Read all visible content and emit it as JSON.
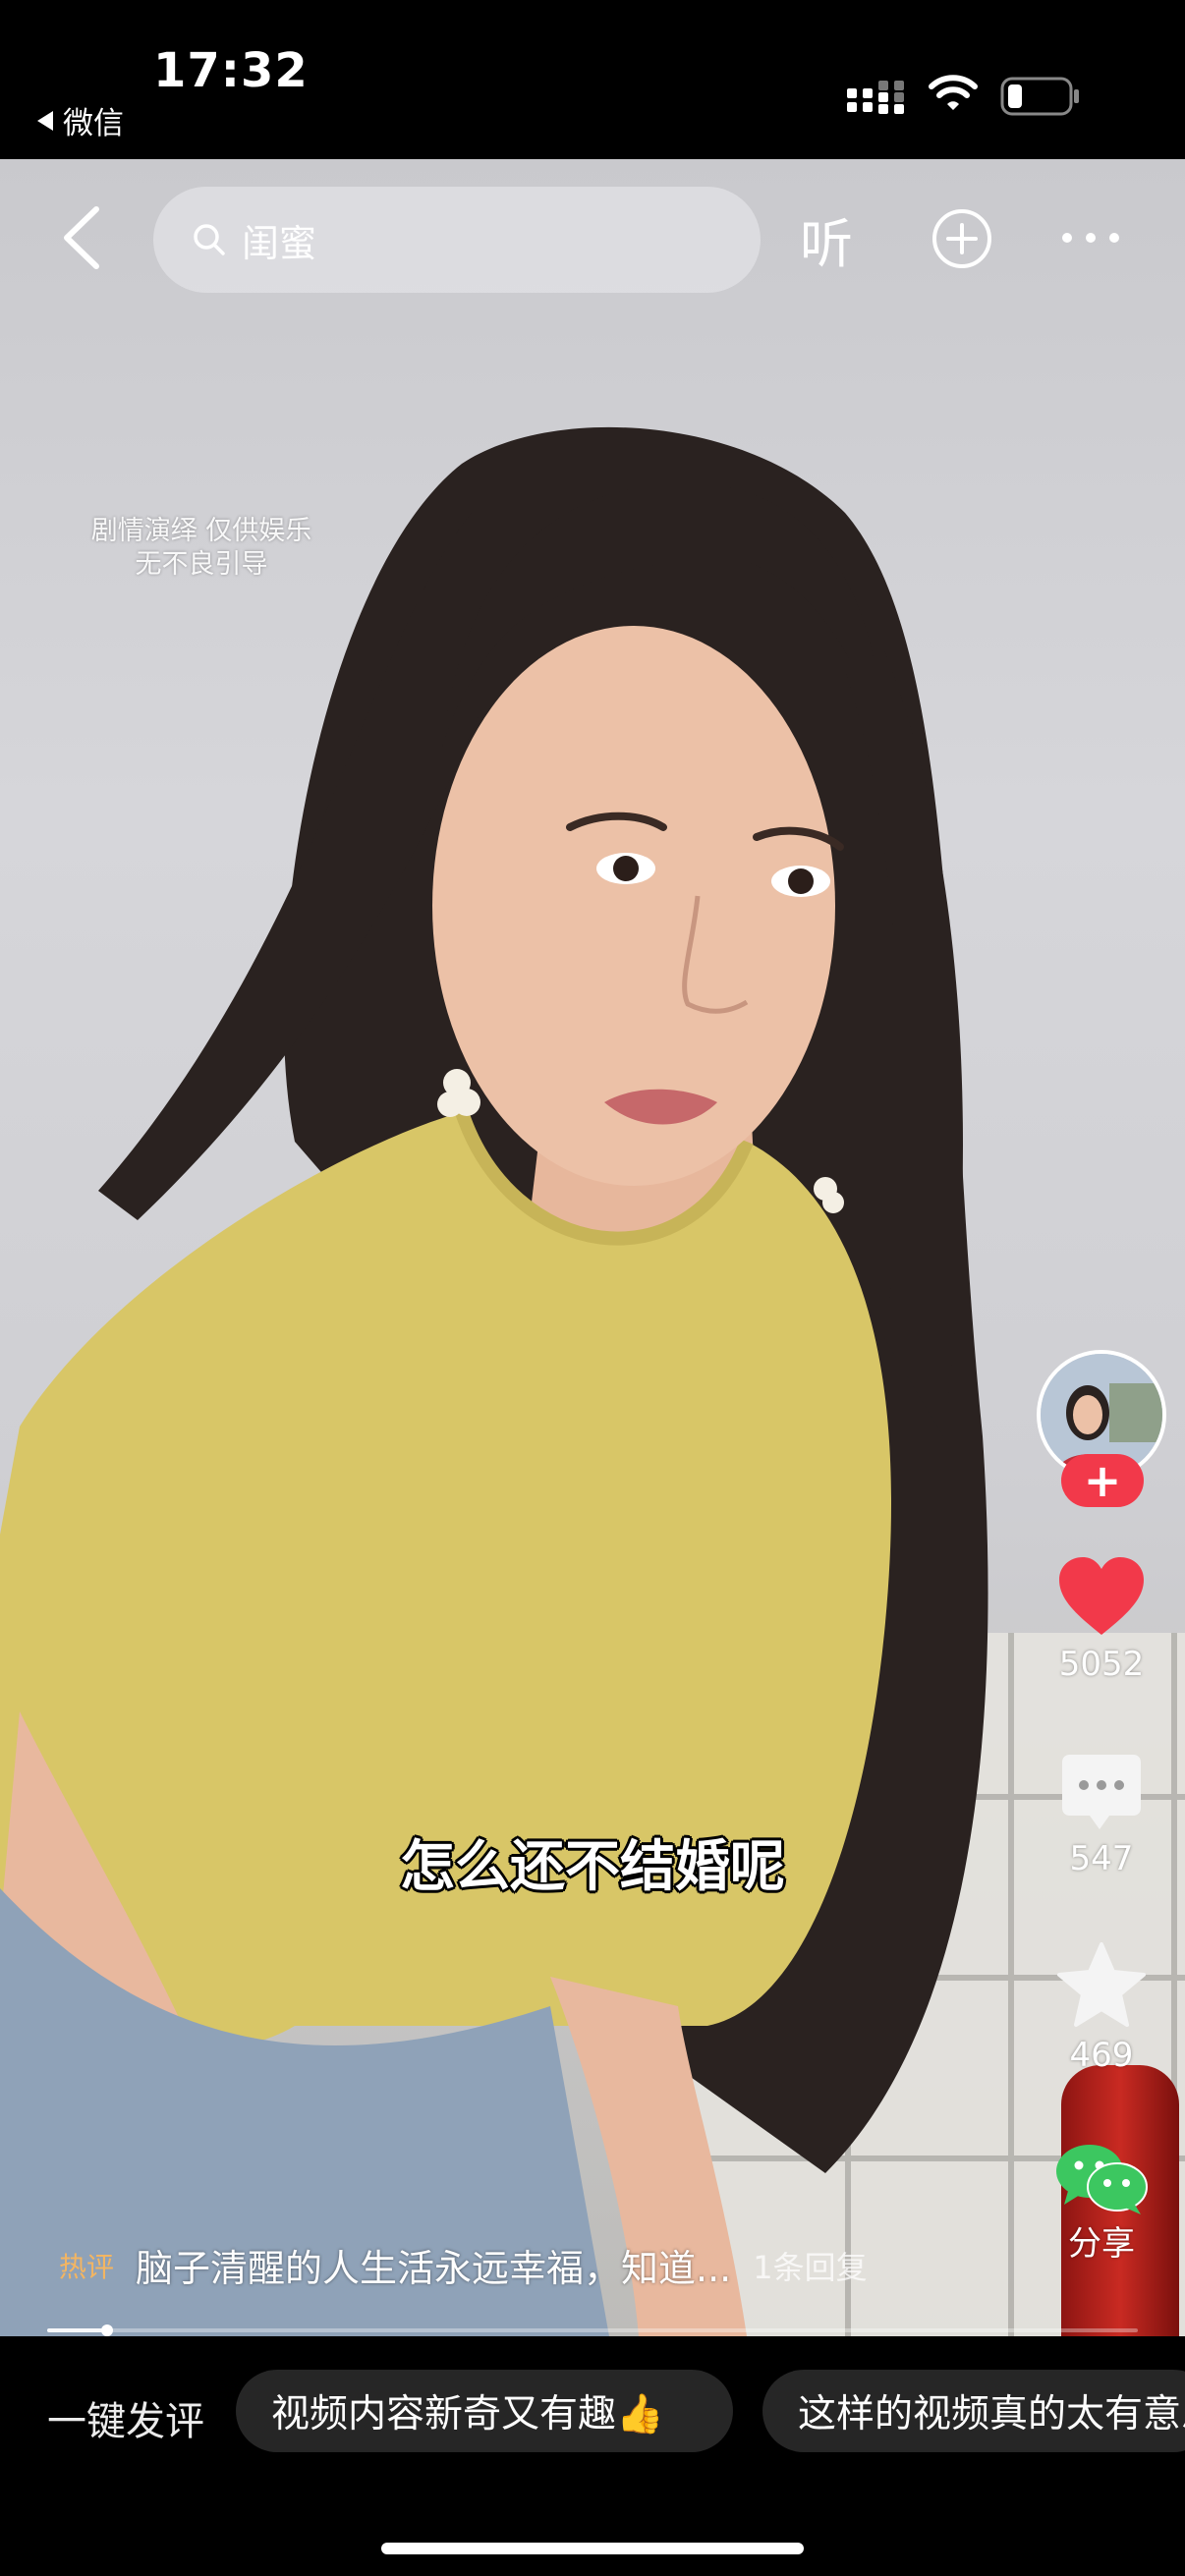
{
  "status_bar": {
    "time": "17:32",
    "back_app": "微信",
    "icons": [
      "cellular-signal-icon",
      "wifi-icon",
      "battery-icon"
    ]
  },
  "top_nav": {
    "search_text": "闺蜜",
    "listen_label": "听",
    "icons": [
      "back-chevron-icon",
      "search-icon",
      "add-circle-icon",
      "more-dots-icon"
    ]
  },
  "video": {
    "disclaimer_line1": "剧情演绎 仅供娱乐",
    "disclaimer_line2": "无不良引导",
    "subtitle": "怎么还不结婚呢"
  },
  "actions": {
    "follow_label": "+",
    "likes": "5052",
    "comments": "547",
    "favorites": "469",
    "share_label": "分享",
    "like_color": "#f2394a"
  },
  "hot_comment": {
    "tag": "热评",
    "text": "脑子清醒的人生活永远幸福，知道...",
    "reply": "1条回复"
  },
  "progress": {
    "fraction": 0.055
  },
  "bottom_bar": {
    "one_click_label": "一键发评",
    "quick_comments": [
      "视频内容新奇又有趣👍",
      "这样的视频真的太有意思了"
    ]
  }
}
